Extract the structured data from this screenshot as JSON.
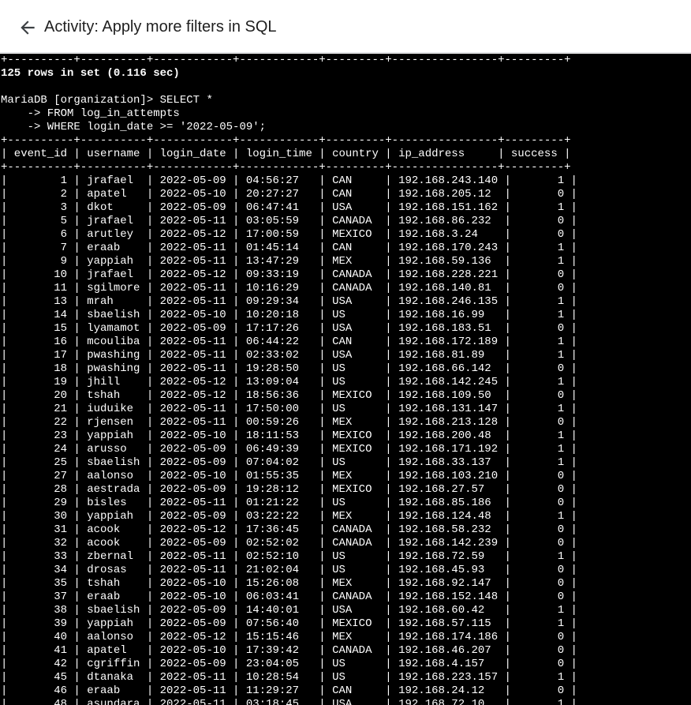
{
  "header": {
    "title": "Activity: Apply more filters in SQL"
  },
  "terminal": {
    "lines": [
      "+----------+----------+------------+------------+---------+----------------+---------+",
      "125 rows in set (0.116 sec)",
      "",
      "MariaDB [organization]> SELECT *",
      "    -> FROM log_in_attempts",
      "    -> WHERE login_date >= '2022-05-09';",
      "+----------+----------+------------+------------+---------+----------------+---------+",
      "| event_id | username | login_date | login_time | country | ip_address     | success |",
      "+----------+----------+------------+------------+---------+----------------+---------+",
      "|        1 | jrafael  | 2022-05-09 | 04:56:27   | CAN     | 192.168.243.140 |       1 |",
      "|        2 | apatel   | 2022-05-10 | 20:27:27   | CAN     | 192.168.205.12  |       0 |",
      "|        3 | dkot     | 2022-05-09 | 06:47:41   | USA     | 192.168.151.162 |       1 |",
      "|        5 | jrafael  | 2022-05-11 | 03:05:59   | CANADA  | 192.168.86.232  |       0 |",
      "|        6 | arutley  | 2022-05-12 | 17:00:59   | MEXICO  | 192.168.3.24    |       0 |",
      "|        7 | eraab    | 2022-05-11 | 01:45:14   | CAN     | 192.168.170.243 |       1 |",
      "|        9 | yappiah  | 2022-05-11 | 13:47:29   | MEX     | 192.168.59.136  |       1 |",
      "|       10 | jrafael  | 2022-05-12 | 09:33:19   | CANADA  | 192.168.228.221 |       0 |",
      "|       11 | sgilmore | 2022-05-11 | 10:16:29   | CANADA  | 192.168.140.81  |       0 |",
      "|       13 | mrah     | 2022-05-11 | 09:29:34   | USA     | 192.168.246.135 |       1 |",
      "|       14 | sbaelish | 2022-05-10 | 10:20:18   | US      | 192.168.16.99   |       1 |",
      "|       15 | lyamamot | 2022-05-09 | 17:17:26   | USA     | 192.168.183.51  |       0 |",
      "|       16 | mcouliba | 2022-05-11 | 06:44:22   | CAN     | 192.168.172.189 |       1 |",
      "|       17 | pwashing | 2022-05-11 | 02:33:02   | USA     | 192.168.81.89   |       1 |",
      "|       18 | pwashing | 2022-05-11 | 19:28:50   | US      | 192.168.66.142  |       0 |",
      "|       19 | jhill    | 2022-05-12 | 13:09:04   | US      | 192.168.142.245 |       1 |",
      "|       20 | tshah    | 2022-05-12 | 18:56:36   | MEXICO  | 192.168.109.50  |       0 |",
      "|       21 | iuduike  | 2022-05-11 | 17:50:00   | US      | 192.168.131.147 |       1 |",
      "|       22 | rjensen  | 2022-05-11 | 00:59:26   | MEX     | 192.168.213.128 |       0 |",
      "|       23 | yappiah  | 2022-05-10 | 18:11:53   | MEXICO  | 192.168.200.48  |       1 |",
      "|       24 | arusso   | 2022-05-09 | 06:49:39   | MEXICO  | 192.168.171.192 |       1 |",
      "|       25 | sbaelish | 2022-05-09 | 07:04:02   | US      | 192.168.33.137  |       1 |",
      "|       27 | aalonso  | 2022-05-10 | 01:55:35   | MEX     | 192.168.103.210 |       0 |",
      "|       28 | aestrada | 2022-05-09 | 19:28:12   | MEXICO  | 192.168.27.57   |       0 |",
      "|       29 | bisles   | 2022-05-11 | 01:21:22   | US      | 192.168.85.186  |       0 |",
      "|       30 | yappiah  | 2022-05-09 | 03:22:22   | MEX     | 192.168.124.48  |       1 |",
      "|       31 | acook    | 2022-05-12 | 17:36:45   | CANADA  | 192.168.58.232  |       0 |",
      "|       32 | acook    | 2022-05-09 | 02:52:02   | CANADA  | 192.168.142.239 |       0 |",
      "|       33 | zbernal  | 2022-05-11 | 02:52:10   | US      | 192.168.72.59   |       1 |",
      "|       34 | drosas   | 2022-05-11 | 21:02:04   | US      | 192.168.45.93   |       0 |",
      "|       35 | tshah    | 2022-05-10 | 15:26:08   | MEX     | 192.168.92.147  |       0 |",
      "|       37 | eraab    | 2022-05-10 | 06:03:41   | CANADA  | 192.168.152.148 |       0 |",
      "|       38 | sbaelish | 2022-05-09 | 14:40:01   | USA     | 192.168.60.42   |       1 |",
      "|       39 | yappiah  | 2022-05-09 | 07:56:40   | MEXICO  | 192.168.57.115  |       1 |",
      "|       40 | aalonso  | 2022-05-12 | 15:15:46   | MEX     | 192.168.174.186 |       0 |",
      "|       41 | apatel   | 2022-05-10 | 17:39:42   | CANADA  | 192.168.46.207  |       0 |",
      "|       42 | cgriffin | 2022-05-09 | 23:04:05   | US      | 192.168.4.157   |       0 |",
      "|       45 | dtanaka  | 2022-05-11 | 10:28:54   | US      | 192.168.223.157 |       1 |",
      "|       46 | eraab    | 2022-05-11 | 11:29:27   | CAN     | 192.168.24.12   |       0 |",
      "|       48 | asundara | 2022-05-11 | 03:18:45   | USA     | 192.168.72.10   |       1 |"
    ]
  }
}
